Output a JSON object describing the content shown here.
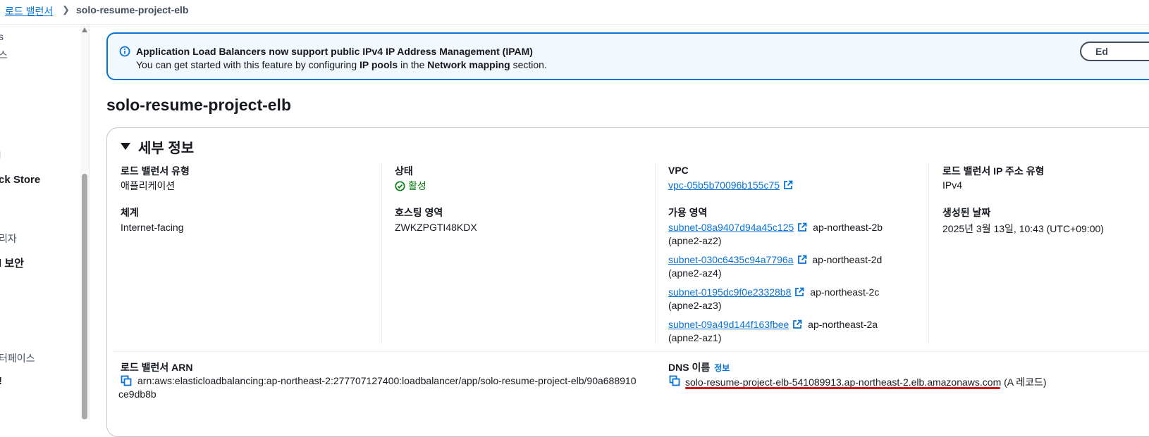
{
  "breadcrumb": {
    "parent": "로드 밸런서",
    "current": "solo-resume-project-elb"
  },
  "sidebar": {
    "items": [
      "s",
      "스",
      "l",
      "ck Store",
      "리자",
      "l 보안",
      "터페이스",
      "!"
    ]
  },
  "banner": {
    "title": "Application Load Balancers now support public IPv4 IP Address Management (IPAM)",
    "body_prefix": "You can get started with this feature by configuring",
    "body_bold1": "IP pools",
    "body_middle": "in the",
    "body_bold2": "Network mapping",
    "body_suffix": "section.",
    "button_label": "Ed"
  },
  "page_title": "solo-resume-project-elb",
  "details": {
    "section_title": "세부 정보",
    "lb_type_label": "로드 밸런서 유형",
    "lb_type_value": "애플리케이션",
    "scheme_label": "체계",
    "scheme_value": "Internet-facing",
    "status_label": "상태",
    "status_value": "활성",
    "hosted_zone_label": "호스팅 영역",
    "hosted_zone_value": "ZWKZPGTI48KDX",
    "vpc_label": "VPC",
    "vpc_value": "vpc-05b5b70096b155c75",
    "az_label": "가용 영역",
    "subnets": [
      {
        "id": "subnet-08a9407d94a45c125",
        "az": "ap-northeast-2b",
        "zone_id": "(apne2-az2)"
      },
      {
        "id": "subnet-030c6435c94a7796a",
        "az": "ap-northeast-2d",
        "zone_id": "(apne2-az4)"
      },
      {
        "id": "subnet-0195dc9f0e23328b8",
        "az": "ap-northeast-2c",
        "zone_id": "(apne2-az3)"
      },
      {
        "id": "subnet-09a49d144f163fbee",
        "az": "ap-northeast-2a",
        "zone_id": "(apne2-az1)"
      }
    ],
    "ip_type_label": "로드 밸런서 IP 주소 유형",
    "ip_type_value": "IPv4",
    "created_label": "생성된 날짜",
    "created_value": "2025년 3월 13일, 10:43 (UTC+09:00)",
    "arn_label": "로드 밸런서 ARN",
    "arn_line1": "arn:aws:elasticloadbalancing:ap-northeast-2:277707127400:loadbalancer/app/solo-resume-project-elb/90a688910",
    "arn_line2": "ce9db8b",
    "dns_label": "DNS 이름",
    "dns_info_link": "정보",
    "dns_value": "solo-resume-project-elb-541089913.ap-northeast-2.elb.amazonaws.com",
    "dns_record": "(A 레코드)"
  },
  "colors": {
    "link": "#0972d3",
    "status_ok": "#037f0c",
    "banner_border": "#0972d3",
    "banner_bg": "#f2f8fd",
    "annotation_underline": "#d91515"
  }
}
